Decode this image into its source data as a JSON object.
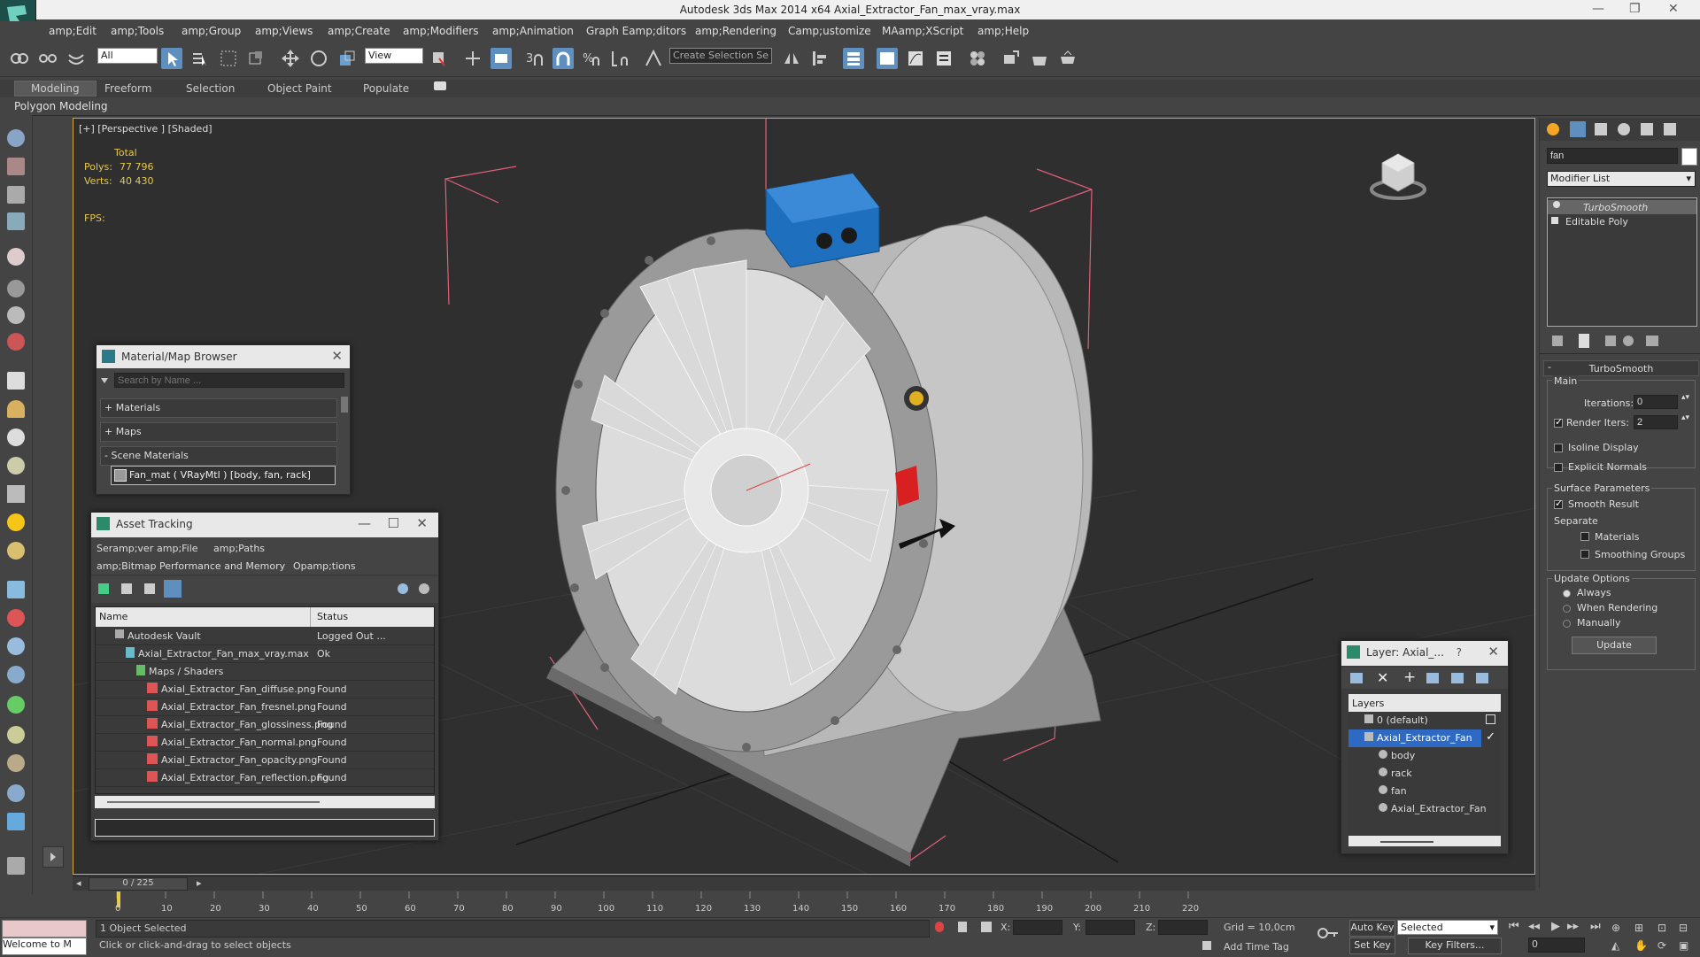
{
  "titlebar": {
    "title": "Autodesk 3ds Max  2014 x64     Axial_Extractor_Fan_max_vray.max"
  },
  "menu": [
    "amp;Edit",
    "amp;Tools",
    "amp;Group",
    "amp;Views",
    "amp;Create",
    "amp;Modifiers",
    "amp;Animation",
    "Graph Eamp;ditors",
    "amp;Rendering",
    "Camp;ustomize",
    "MAamp;XScript",
    "amp;Help"
  ],
  "toolbar": {
    "selection_filter": "All",
    "ref_coord": "View",
    "selection_set": "Create Selection Se"
  },
  "ribbon": {
    "tabs": [
      "Modeling",
      "Freeform",
      "Selection",
      "Object Paint",
      "Populate"
    ],
    "subtab": "Polygon Modeling"
  },
  "viewport": {
    "label": "[+] [Perspective ] [Shaded]",
    "stats": {
      "total_label": "Total",
      "polys_label": "Polys:",
      "polys": "77 796",
      "verts_label": "Verts:",
      "verts": "40 430",
      "fps_label": "FPS:"
    }
  },
  "material_browser": {
    "title": "Material/Map Browser",
    "search_placeholder": "Search by Name ...",
    "groups": [
      "+ Materials",
      "+ Maps",
      "- Scene Materials"
    ],
    "item": "Fan_mat  ( VRayMtl ) [body, fan, rack]"
  },
  "asset_tracking": {
    "title": "Asset Tracking",
    "menu1": [
      "Seramp;ver",
      "amp;File",
      "amp;Paths"
    ],
    "menu2": [
      "amp;Bitmap Performance and Memory",
      "Opamp;tions"
    ],
    "columns": [
      "Name",
      "Status"
    ],
    "rows": [
      {
        "name": "Autodesk Vault",
        "status": "Logged Out ..."
      },
      {
        "name": "Axial_Extractor_Fan_max_vray.max",
        "status": "Ok"
      },
      {
        "name": "Maps / Shaders",
        "status": ""
      },
      {
        "name": "Axial_Extractor_Fan_diffuse.png",
        "status": "Found"
      },
      {
        "name": "Axial_Extractor_Fan_fresnel.png",
        "status": "Found"
      },
      {
        "name": "Axial_Extractor_Fan_glossiness.png",
        "status": "Found"
      },
      {
        "name": "Axial_Extractor_Fan_normal.png",
        "status": "Found"
      },
      {
        "name": "Axial_Extractor_Fan_opacity.png",
        "status": "Found"
      },
      {
        "name": "Axial_Extractor_Fan_reflection.png",
        "status": "Found"
      }
    ]
  },
  "layer_window": {
    "title": "Layer: Axial_...",
    "help": "?",
    "header": "Layers",
    "rows": [
      {
        "name": "0 (default)",
        "selected": false
      },
      {
        "name": "Axial_Extractor_Fan",
        "selected": true
      },
      {
        "name": "body",
        "selected": false
      },
      {
        "name": "rack",
        "selected": false
      },
      {
        "name": "fan",
        "selected": false
      },
      {
        "name": "Axial_Extractor_Fan",
        "selected": false
      }
    ]
  },
  "command_panel": {
    "object_name": "fan",
    "modifier_list": "Modifier List",
    "stack": [
      "TurboSmooth",
      "Editable Poly"
    ],
    "rollout_title": "TurboSmooth",
    "main_label": "Main",
    "iterations_label": "Iterations:",
    "iterations": "0",
    "render_iters_label": "Render Iters:",
    "render_iters": "2",
    "isoline": "Isoline Display",
    "explicit_normals": "Explicit Normals",
    "surface_params": "Surface Parameters",
    "smooth_result": "Smooth Result",
    "separate": "Separate",
    "materials": "Materials",
    "smoothing_groups": "Smoothing Groups",
    "update_options": "Update Options",
    "always": "Always",
    "when_rendering": "When Rendering",
    "manually": "Manually",
    "update_button": "Update"
  },
  "timeline": {
    "frame": "0 / 225",
    "ticks": [
      "0",
      "10",
      "20",
      "30",
      "40",
      "50",
      "60",
      "70",
      "80",
      "90",
      "100",
      "110",
      "120",
      "130",
      "140",
      "150",
      "160",
      "170",
      "180",
      "190",
      "200",
      "210",
      "220"
    ]
  },
  "status": {
    "listener": "Welcome to M",
    "selected": "1 Object Selected",
    "prompt": "Click or click-and-drag to select objects",
    "x": "X:",
    "y": "Y:",
    "z": "Z:",
    "grid": "Grid = 10,0cm",
    "add_time_tag": "Add Time Tag",
    "auto_key": "Auto Key",
    "set_key": "Set Key",
    "selected_drop": "Selected",
    "key_filters": "Key Filters...",
    "frame_field": "0"
  },
  "colors": {
    "accent": "#5e8fbf",
    "viewport_border": "#d6a93a",
    "stats": "#e6c84a",
    "bbox": "#e0607a"
  }
}
